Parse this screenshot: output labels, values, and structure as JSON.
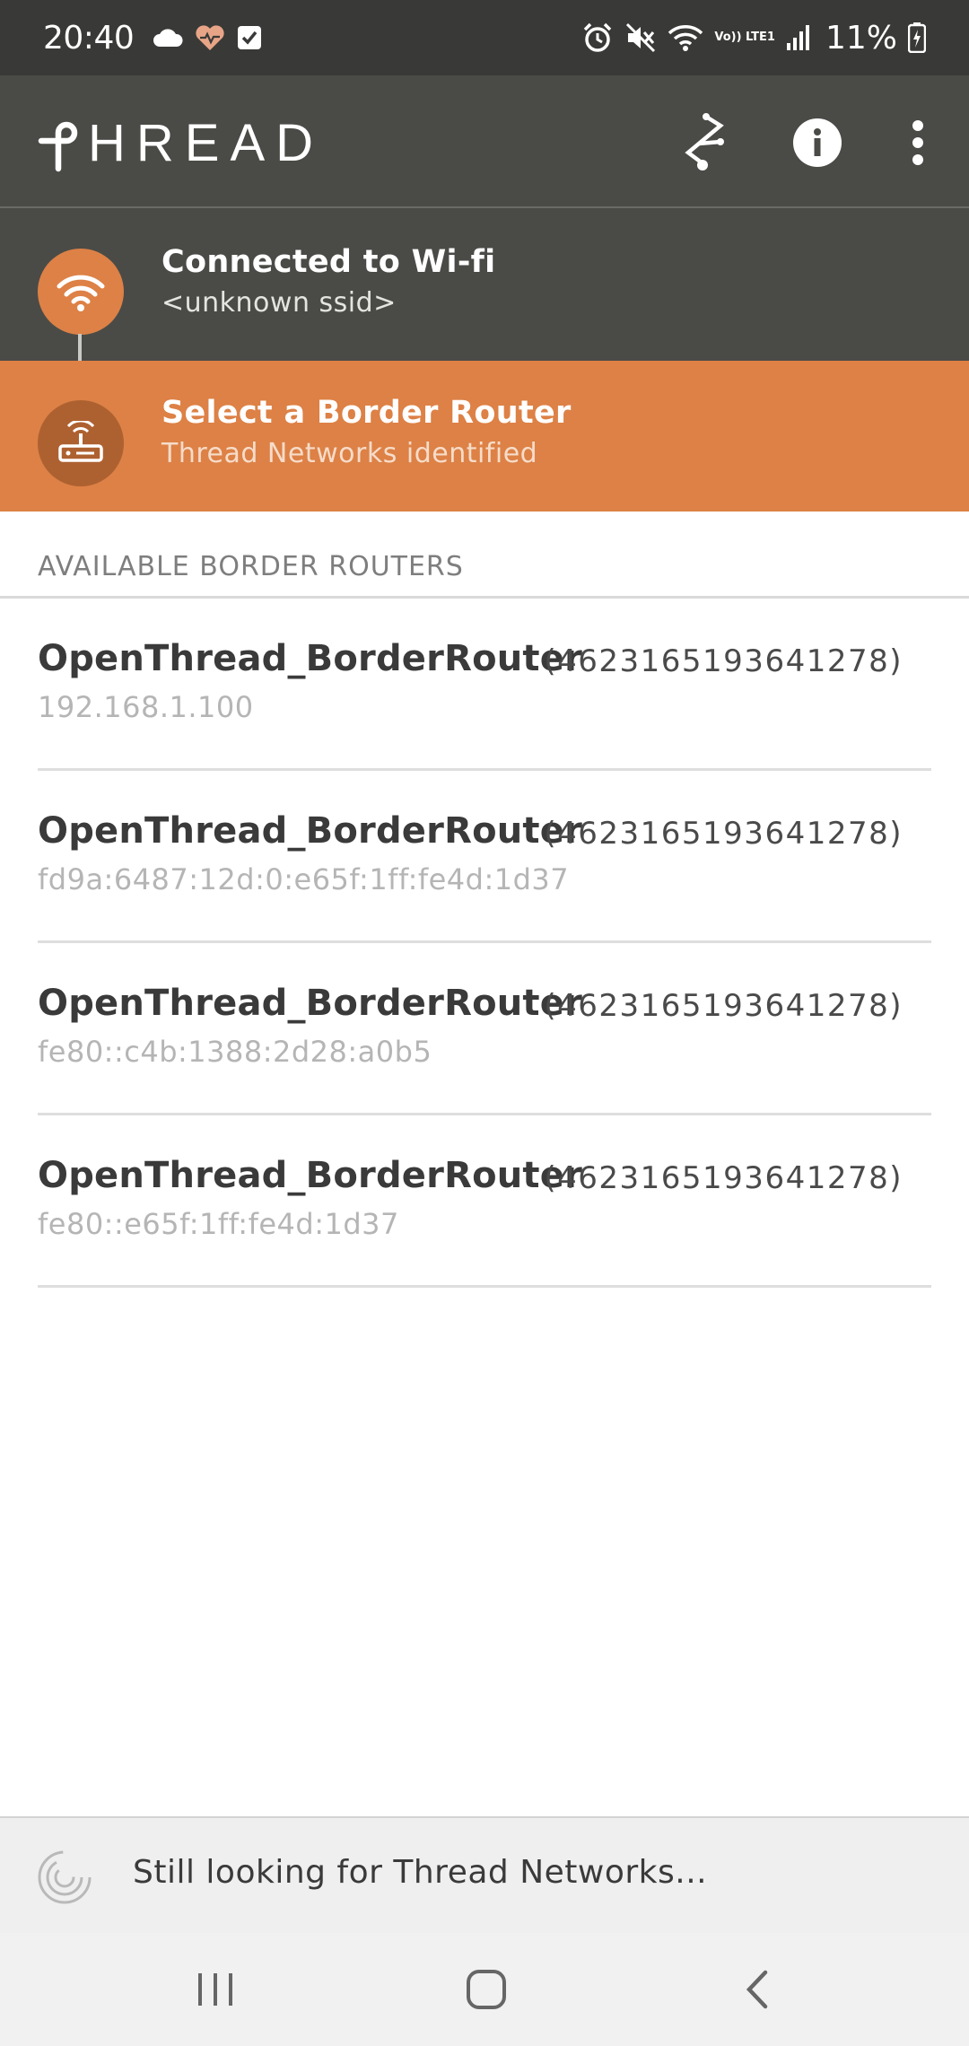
{
  "status_bar": {
    "time": "20:40",
    "battery": "11%",
    "left_icons": [
      "cloud-icon",
      "heart-icon",
      "checkbox-icon"
    ],
    "right_icons": [
      "alarm-icon",
      "mute-icon",
      "wifi-icon",
      "volte-icon",
      "signal-icon",
      "battery-charging-icon"
    ],
    "volte_label": "Vo)) LTE1"
  },
  "app_bar": {
    "logo_text": "HREAD",
    "actions": [
      "thread-network-icon",
      "info-icon",
      "more-vert-icon"
    ]
  },
  "wifi_step": {
    "title": "Connected to Wi-fi",
    "subtitle": "<unknown ssid>"
  },
  "router_step": {
    "title": "Select a Border Router",
    "subtitle": "Thread Networks identified"
  },
  "section": {
    "header": "AVAILABLE BORDER ROUTERS"
  },
  "routers": [
    {
      "name": "OpenThread_BorderRouter",
      "id": "(4623165193641278)",
      "address": "192.168.1.100"
    },
    {
      "name": "OpenThread_BorderRouter",
      "id": "(4623165193641278)",
      "address": "fd9a:6487:12d:0:e65f:1ff:fe4d:1d37"
    },
    {
      "name": "OpenThread_BorderRouter",
      "id": "(4623165193641278)",
      "address": "fe80::c4b:1388:2d28:a0b5"
    },
    {
      "name": "OpenThread_BorderRouter",
      "id": "(4623165193641278)",
      "address": "fe80::e65f:1ff:fe4d:1d37"
    }
  ],
  "footer": {
    "text": "Still looking for Thread Networks..."
  },
  "nav_bar": {
    "buttons": [
      "recents-icon",
      "home-icon",
      "back-icon"
    ]
  },
  "colors": {
    "status_bar": "#393a37",
    "app_bar": "#4a4b47",
    "accent": "#dd8146",
    "accent_dark": "#b0622e",
    "router_subtitle": "#f6dcc9"
  }
}
